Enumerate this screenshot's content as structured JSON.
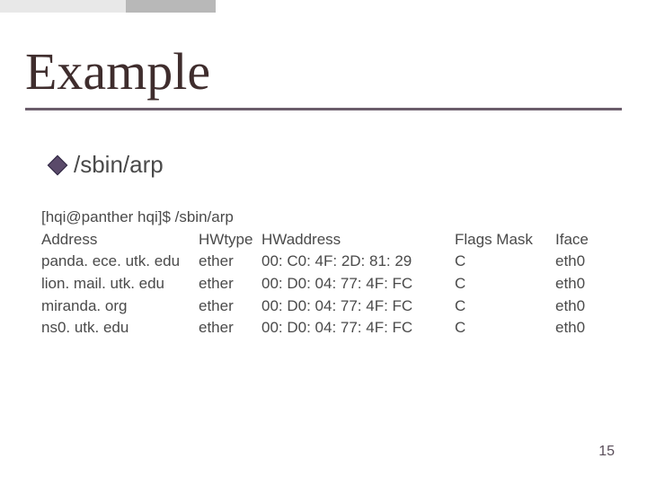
{
  "title": "Example",
  "bullet_text": "/sbin/arp",
  "prompt_line": "[hqi@panther hqi]$ /sbin/arp",
  "headers": {
    "address": "Address",
    "hwtype": "HWtype",
    "hwaddress": "HWaddress",
    "flags": "Flags Mask",
    "iface": "Iface"
  },
  "rows": [
    {
      "address": "panda. ece. utk. edu",
      "hwtype": "ether",
      "hwaddress": "00: C0: 4F: 2D: 81: 29",
      "flags": "C",
      "iface": "eth0"
    },
    {
      "address": "lion. mail. utk. edu",
      "hwtype": "ether",
      "hwaddress": "00: D0: 04: 77: 4F: FC",
      "flags": "C",
      "iface": "eth0"
    },
    {
      "address": "miranda. org",
      "hwtype": "ether",
      "hwaddress": "00: D0: 04: 77: 4F: FC",
      "flags": "C",
      "iface": "eth0"
    },
    {
      "address": "ns0. utk. edu",
      "hwtype": "ether",
      "hwaddress": "00: D0: 04: 77: 4F: FC",
      "flags": "C",
      "iface": "eth0"
    }
  ],
  "page_number": "15"
}
